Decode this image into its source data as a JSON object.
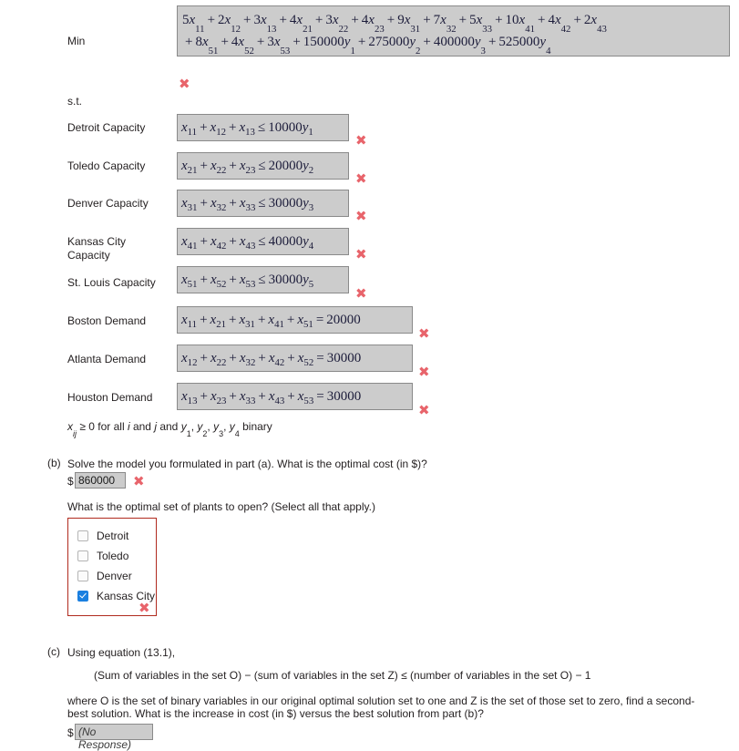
{
  "objective": {
    "label": "Min",
    "line1": "5x11 + 2x12 + 3x13 + 4x21 + 3x22 + 4x23 + 9x31 + 7x32 + 5x33 + 10x41 + 4x42 + 2x43",
    "line2": "+ 8x51 + 4x52 + 3x53 + 150000y1 + 275000y2 + 400000y3 + 525000y4",
    "terms_line1": [
      {
        "coef": "5",
        "var": "x",
        "sub": "11"
      },
      {
        "coef": "2",
        "var": "x",
        "sub": "12"
      },
      {
        "coef": "3",
        "var": "x",
        "sub": "13"
      },
      {
        "coef": "4",
        "var": "x",
        "sub": "21"
      },
      {
        "coef": "3",
        "var": "x",
        "sub": "22"
      },
      {
        "coef": "4",
        "var": "x",
        "sub": "23"
      },
      {
        "coef": "9",
        "var": "x",
        "sub": "31"
      },
      {
        "coef": "7",
        "var": "x",
        "sub": "32"
      },
      {
        "coef": "5",
        "var": "x",
        "sub": "33"
      },
      {
        "coef": "10",
        "var": "x",
        "sub": "41"
      },
      {
        "coef": "4",
        "var": "x",
        "sub": "42"
      },
      {
        "coef": "2",
        "var": "x",
        "sub": "43"
      }
    ],
    "terms_line2": [
      {
        "coef": "8",
        "var": "x",
        "sub": "51"
      },
      {
        "coef": "4",
        "var": "x",
        "sub": "52"
      },
      {
        "coef": "3",
        "var": "x",
        "sub": "53"
      },
      {
        "coef": "150000",
        "var": "y",
        "sub": "1"
      },
      {
        "coef": "275000",
        "var": "y",
        "sub": "2"
      },
      {
        "coef": "400000",
        "var": "y",
        "sub": "3"
      },
      {
        "coef": "525000",
        "var": "y",
        "sub": "4"
      }
    ],
    "incorrect_mark": "✖"
  },
  "subject_to_label": "s.t.",
  "constraints": [
    {
      "name": "Detroit Capacity",
      "expr": "x11 + x12 + x13 ≤ 10000y1",
      "lhs": [
        {
          "var": "x",
          "sub": "11"
        },
        {
          "var": "x",
          "sub": "12"
        },
        {
          "var": "x",
          "sub": "13"
        }
      ],
      "relation": "≤",
      "rhs_coef": "10000",
      "rhs_var": "y",
      "rhs_sub": "1",
      "mark": "✖"
    },
    {
      "name": "Toledo Capacity",
      "expr": "x21 + x22 + x23 ≤ 20000y2",
      "lhs": [
        {
          "var": "x",
          "sub": "21"
        },
        {
          "var": "x",
          "sub": "22"
        },
        {
          "var": "x",
          "sub": "23"
        }
      ],
      "relation": "≤",
      "rhs_coef": "20000",
      "rhs_var": "y",
      "rhs_sub": "2",
      "mark": "✖"
    },
    {
      "name": "Denver Capacity",
      "expr": "x31 + x32 + x33 ≤ 30000y3",
      "lhs": [
        {
          "var": "x",
          "sub": "31"
        },
        {
          "var": "x",
          "sub": "32"
        },
        {
          "var": "x",
          "sub": "33"
        }
      ],
      "relation": "≤",
      "rhs_coef": "30000",
      "rhs_var": "y",
      "rhs_sub": "3",
      "mark": "✖"
    },
    {
      "name": "Kansas City\nCapacity",
      "expr": "x41 + x42 + x43 ≤ 40000y4",
      "lhs": [
        {
          "var": "x",
          "sub": "41"
        },
        {
          "var": "x",
          "sub": "42"
        },
        {
          "var": "x",
          "sub": "43"
        }
      ],
      "relation": "≤",
      "rhs_coef": "40000",
      "rhs_var": "y",
      "rhs_sub": "4",
      "mark": "✖"
    },
    {
      "name": "St. Louis Capacity",
      "expr": "x51 + x52 + x53 ≤ 30000y5",
      "lhs": [
        {
          "var": "x",
          "sub": "51"
        },
        {
          "var": "x",
          "sub": "52"
        },
        {
          "var": "x",
          "sub": "53"
        }
      ],
      "relation": "≤",
      "rhs_coef": "30000",
      "rhs_var": "y",
      "rhs_sub": "5",
      "mark": "✖"
    },
    {
      "name": "Boston Demand",
      "expr": "x11 + x21 + x31 + x41 + x51 = 20000",
      "lhs": [
        {
          "var": "x",
          "sub": "11"
        },
        {
          "var": "x",
          "sub": "21"
        },
        {
          "var": "x",
          "sub": "31"
        },
        {
          "var": "x",
          "sub": "41"
        },
        {
          "var": "x",
          "sub": "51"
        }
      ],
      "relation": "=",
      "rhs_coef": "20000",
      "rhs_var": "",
      "rhs_sub": "",
      "mark": "✖"
    },
    {
      "name": "Atlanta Demand",
      "expr": "x12 + x22 + x32 + x42 + x52 = 30000",
      "lhs": [
        {
          "var": "x",
          "sub": "12"
        },
        {
          "var": "x",
          "sub": "22"
        },
        {
          "var": "x",
          "sub": "32"
        },
        {
          "var": "x",
          "sub": "42"
        },
        {
          "var": "x",
          "sub": "52"
        }
      ],
      "relation": "=",
      "rhs_coef": "30000",
      "rhs_var": "",
      "rhs_sub": "",
      "mark": "✖"
    },
    {
      "name": "Houston Demand",
      "expr": "x13 + x23 + x33 + x43 + x53 = 30000",
      "lhs": [
        {
          "var": "x",
          "sub": "13"
        },
        {
          "var": "x",
          "sub": "23"
        },
        {
          "var": "x",
          "sub": "33"
        },
        {
          "var": "x",
          "sub": "43"
        },
        {
          "var": "x",
          "sub": "53"
        }
      ],
      "relation": "=",
      "rhs_coef": "30000",
      "rhs_var": "",
      "rhs_sub": "",
      "mark": "✖"
    }
  ],
  "nonnegativity": "xij ≥ 0 for all i and j and y1, y2, y3, y4 binary",
  "part_b": {
    "marker": "(b)",
    "question": "Solve the model you formulated in part (a). What is the optimal cost (in $)?",
    "dollar": "$",
    "answer_value": "860000",
    "answer_mark": "✖",
    "plants_question": "What is the optimal set of plants to open? (Select all that apply.)",
    "options": [
      {
        "label": "Detroit",
        "checked": false
      },
      {
        "label": "Toledo",
        "checked": false
      },
      {
        "label": "Denver",
        "checked": false
      },
      {
        "label": "Kansas City",
        "checked": true
      }
    ],
    "group_mark": "✖"
  },
  "part_c": {
    "marker": "(c)",
    "intro": "Using equation (13.1),",
    "equation": "(Sum of variables in the set O) − (sum of variables in the set Z) ≤ (number of variables in the set O) − 1",
    "body_line1": "where O is the set of binary variables in our original optimal solution set to one and Z is the set of those set to zero, find a second-",
    "body_line2": "best solution. What is the increase in cost (in $) versus the best solution from part (b)?",
    "dollar": "$",
    "answer_value": "(No Response)"
  },
  "colors": {
    "mark_red": "#e8646b",
    "group_border_red": "#b02a1e",
    "box_fill": "#cccccc",
    "box_border": "#8a8a8a",
    "checked_blue": "#1a7fe0",
    "text": "#231f20"
  }
}
